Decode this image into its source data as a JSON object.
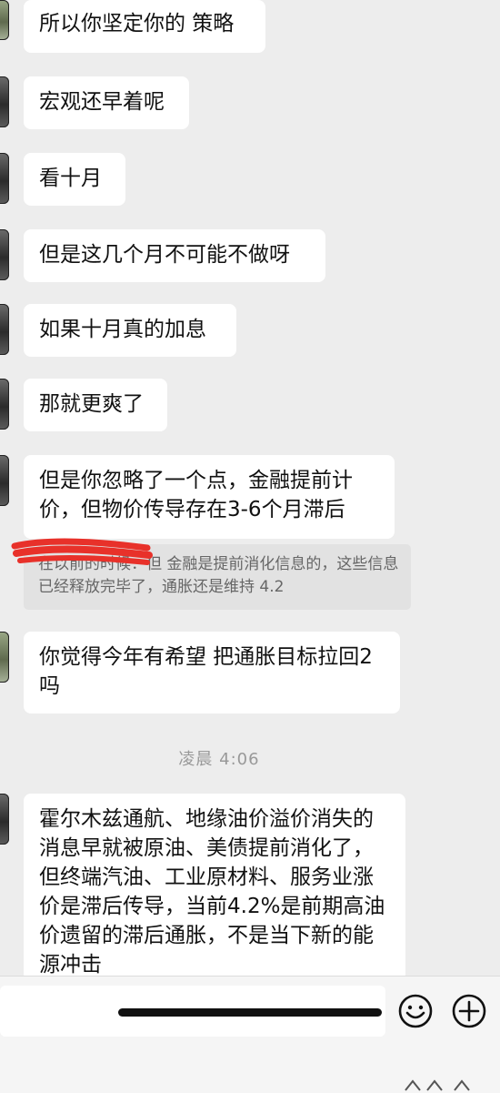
{
  "messages": [
    {
      "text": "所以你坚定你的 策略"
    },
    {
      "text": "宏观还早着呢"
    },
    {
      "text": "看十月"
    },
    {
      "text": "但是这几个月不可能不做呀"
    },
    {
      "text": "如果十月真的加息"
    },
    {
      "text": "那就更爽了"
    },
    {
      "text": "但是你忽略了一个点，金融提前计价，但物价传导存在3-6个月滞后"
    },
    {
      "text": "你觉得今年有希望 把通胀目标拉回2吗"
    },
    {
      "text": "霍尔木兹通航、地缘油价溢价消失的消息早就被原油、美债提前消化了，但终端汽油、工业原材料、服务业涨价是滞后传导，当前4.2%是前期高油价遗留的滞后通胀，不是当下新的能源冲击"
    }
  ],
  "quote": {
    "author": "在以前的时候：",
    "text": "但 金融是提前消化信息的，这些信息已经释放完毕了，通胀还是维持 4.2"
  },
  "timestamp": "凌晨 4:06",
  "input": {
    "value": "",
    "placeholder": ""
  },
  "icons": {
    "emoji": "emoji-icon",
    "plus": "plus-icon"
  },
  "colors": {
    "background": "#ededed",
    "bubble": "#ffffff",
    "quote_bg": "#e2e2e2",
    "scribble": "#e8312a"
  }
}
